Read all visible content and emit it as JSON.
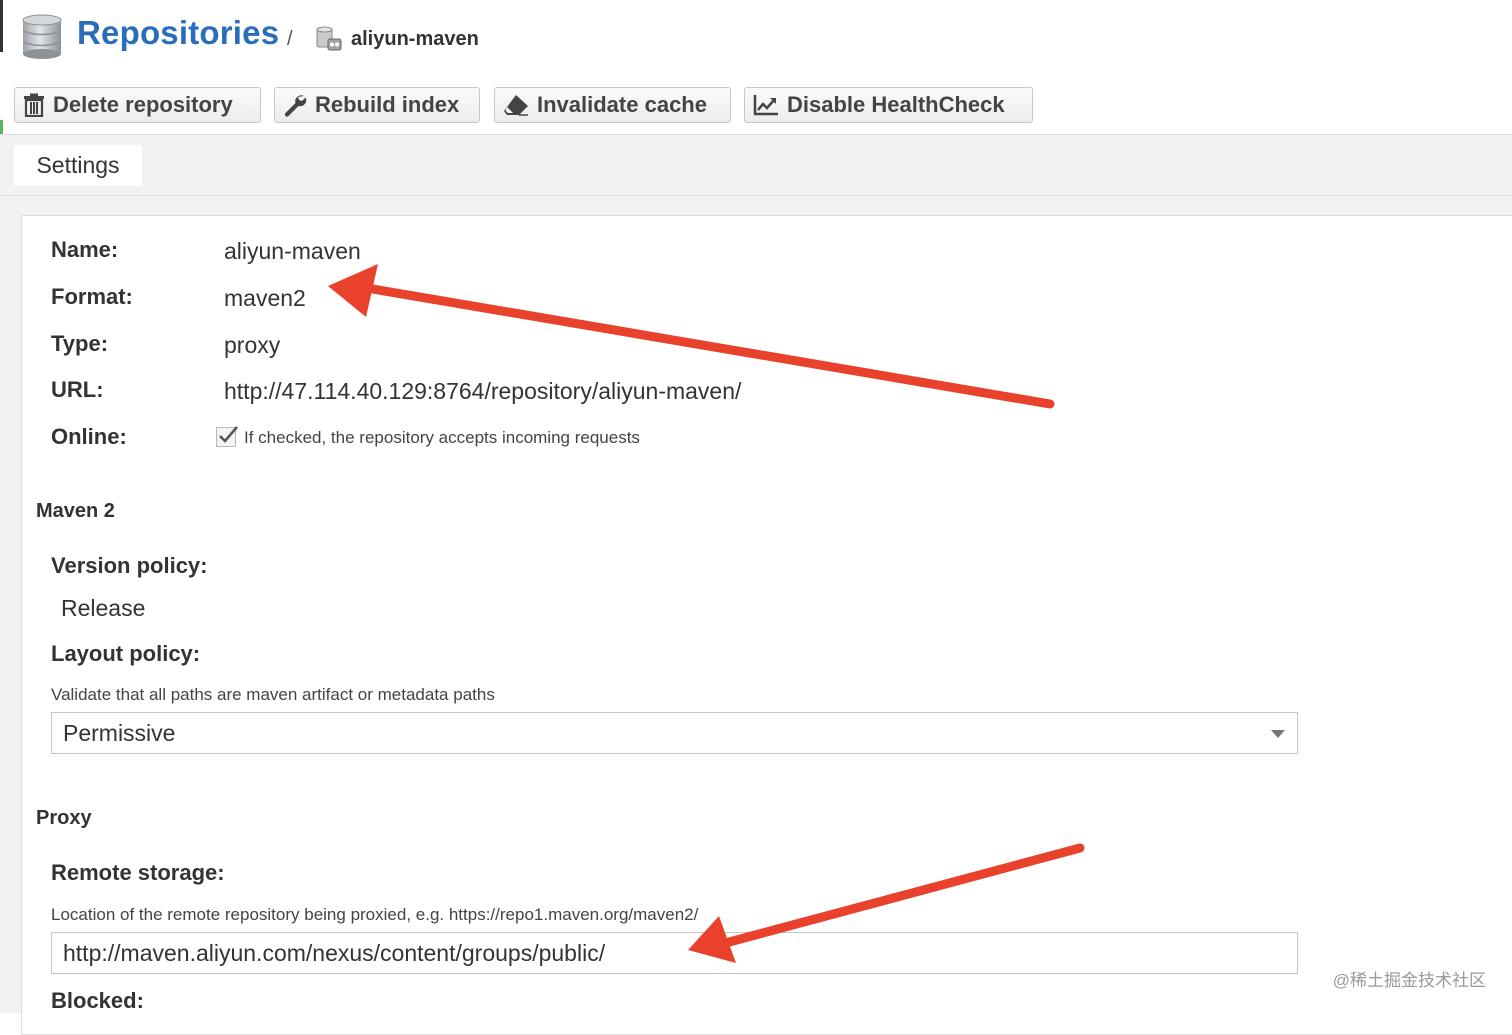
{
  "header": {
    "title": "Repositories",
    "separator": "/",
    "repo_name": "aliyun-maven"
  },
  "toolbar": {
    "delete_label": "Delete repository",
    "rebuild_label": "Rebuild index",
    "invalidate_label": "Invalidate cache",
    "healthcheck_label": "Disable HealthCheck"
  },
  "tabs": [
    {
      "label": "Settings"
    }
  ],
  "settings": {
    "name_label": "Name:",
    "name_value": "aliyun-maven",
    "format_label": "Format:",
    "format_value": "maven2",
    "type_label": "Type:",
    "type_value": "proxy",
    "url_label": "URL:",
    "url_value": "http://47.114.40.129:8764/repository/aliyun-maven/",
    "online_label": "Online:",
    "online_checked": true,
    "online_hint": "If checked, the repository accepts incoming requests"
  },
  "maven2": {
    "section_title": "Maven 2",
    "version_policy_label": "Version policy:",
    "version_policy_value": "Release",
    "layout_policy_label": "Layout policy:",
    "layout_policy_hint": "Validate that all paths are maven artifact or metadata paths",
    "layout_policy_value": "Permissive"
  },
  "proxy": {
    "section_title": "Proxy",
    "remote_storage_label": "Remote storage:",
    "remote_storage_hint": "Location of the remote repository being proxied, e.g. https://repo1.maven.org/maven2/",
    "remote_storage_value": "http://maven.aliyun.com/nexus/content/groups/public/",
    "blocked_label": "Blocked:"
  },
  "watermark": "@稀土掘金技术社区",
  "colors": {
    "title_blue": "#2a6ebb",
    "annotation_red": "#e8412c",
    "accent_green": "#5cb85c"
  }
}
